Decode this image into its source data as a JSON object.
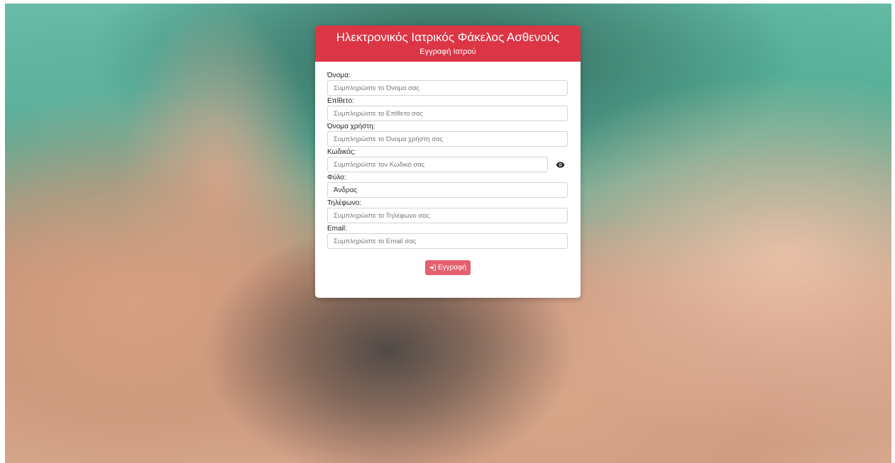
{
  "header": {
    "title": "Ηλεκτρονικός Ιατρικός Φάκελος Ασθενούς",
    "subtitle": "Εγγραφή Ιατρού"
  },
  "form": {
    "first_name": {
      "label": "Όνομα:",
      "placeholder": "Συμπληρώστε το Όνομα σας"
    },
    "last_name": {
      "label": "Επίθετο:",
      "placeholder": "Συμπληρώστε το Επίθετο σας"
    },
    "username": {
      "label": "Όνομα χρήστη:",
      "placeholder": "Συμπληρώστε το Όνομα χρήστη σας"
    },
    "password": {
      "label": "Κωδικός:",
      "placeholder": "Συμπληρώστε τον Κωδικό σας"
    },
    "gender": {
      "label": "Φύλο:",
      "value": "Άνδρας"
    },
    "phone": {
      "label": "Τηλέφωνο:",
      "placeholder": "Συμπληρώστε το Τηλέφωνο σας"
    },
    "email": {
      "label": "Email:",
      "placeholder": "Συμπληρώστε το Email σας"
    },
    "submit_label": "Εγγραφή"
  },
  "icons": {
    "password_toggle": "eye-icon",
    "submit": "sign-in-icon"
  },
  "colors": {
    "header_bg": "#dc3545",
    "button_bg": "#e4606d"
  }
}
